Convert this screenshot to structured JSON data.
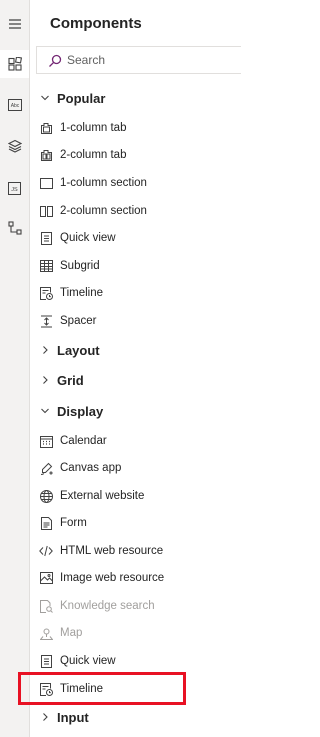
{
  "rail": {
    "items": [
      {
        "name": "hamburger-menu-icon"
      },
      {
        "name": "components-icon"
      },
      {
        "name": "table-columns-icon"
      },
      {
        "name": "layers-icon"
      },
      {
        "name": "js-resource-icon"
      },
      {
        "name": "tree-view-icon"
      }
    ]
  },
  "panel": {
    "title": "Components",
    "search": {
      "placeholder": "Search",
      "value": ""
    },
    "sections": {
      "popular": "Popular",
      "layout": "Layout",
      "grid": "Grid",
      "display": "Display",
      "input": "Input"
    },
    "popular_items": [
      {
        "label": "1-column tab",
        "icon": "one-column-tab-icon"
      },
      {
        "label": "2-column tab",
        "icon": "two-column-tab-icon"
      },
      {
        "label": "1-column section",
        "icon": "one-column-section-icon"
      },
      {
        "label": "2-column section",
        "icon": "two-column-section-icon"
      },
      {
        "label": "Quick view",
        "icon": "quick-view-icon"
      },
      {
        "label": "Subgrid",
        "icon": "subgrid-icon"
      },
      {
        "label": "Timeline",
        "icon": "timeline-icon"
      },
      {
        "label": "Spacer",
        "icon": "spacer-icon"
      }
    ],
    "display_items": [
      {
        "label": "Calendar",
        "icon": "calendar-icon"
      },
      {
        "label": "Canvas app",
        "icon": "canvas-app-icon"
      },
      {
        "label": "External website",
        "icon": "globe-icon"
      },
      {
        "label": "Form",
        "icon": "form-icon"
      },
      {
        "label": "HTML web resource",
        "icon": "code-icon"
      },
      {
        "label": "Image web resource",
        "icon": "image-icon"
      },
      {
        "label": "Knowledge search",
        "icon": "knowledge-search-icon",
        "disabled": true
      },
      {
        "label": "Map",
        "icon": "map-icon",
        "disabled": true
      },
      {
        "label": "Quick view",
        "icon": "quick-view-icon"
      },
      {
        "label": "Timeline",
        "icon": "timeline-icon",
        "highlighted": true
      }
    ]
  },
  "colors": {
    "accent": "#e81123",
    "brand": "#742774"
  }
}
